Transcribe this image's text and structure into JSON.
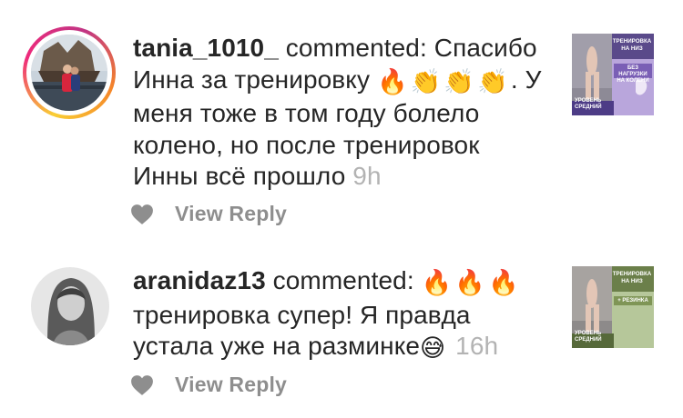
{
  "comments": [
    {
      "username": "tania_1010_",
      "action": "commented:",
      "text_start": "Спасибо Инна за тренировку",
      "emojis": [
        "🔥",
        "👏",
        "👏",
        "👏"
      ],
      "text_end": ". У меня тоже в том году болело колено, но после тренировок Инны всё прошло",
      "time": "9h",
      "reply_label": "View Reply",
      "thumbnail": {
        "title": "ТРЕНИРОВКА НА НИЗ",
        "badge": "БЕЗ НАГРУЗКИ НА КОЛЕНИ",
        "level": "УРОВЕНЬ СРЕДНИЙ",
        "bg_color": "#b9a6dc"
      }
    },
    {
      "username": "aranidaz13",
      "action": "commented:",
      "emojis": [
        "🔥",
        "🔥",
        "🔥"
      ],
      "text": "тренировка супер! Я правда устала уже на разминке",
      "trailing_emoji": "😅",
      "time": "16h",
      "reply_label": "View Reply",
      "thumbnail": {
        "title": "ТРЕНИРОВКА НА НИЗ",
        "badge": "+ РЕЗИНКА",
        "level": "УРОВЕНЬ СРЕДНИЙ",
        "bg_color": "#b6c79a"
      }
    }
  ],
  "colors": {
    "text": "#262626",
    "muted": "#8e8e8e",
    "timestamp": "#b3b3b3",
    "heart": "#8e8e8e"
  }
}
